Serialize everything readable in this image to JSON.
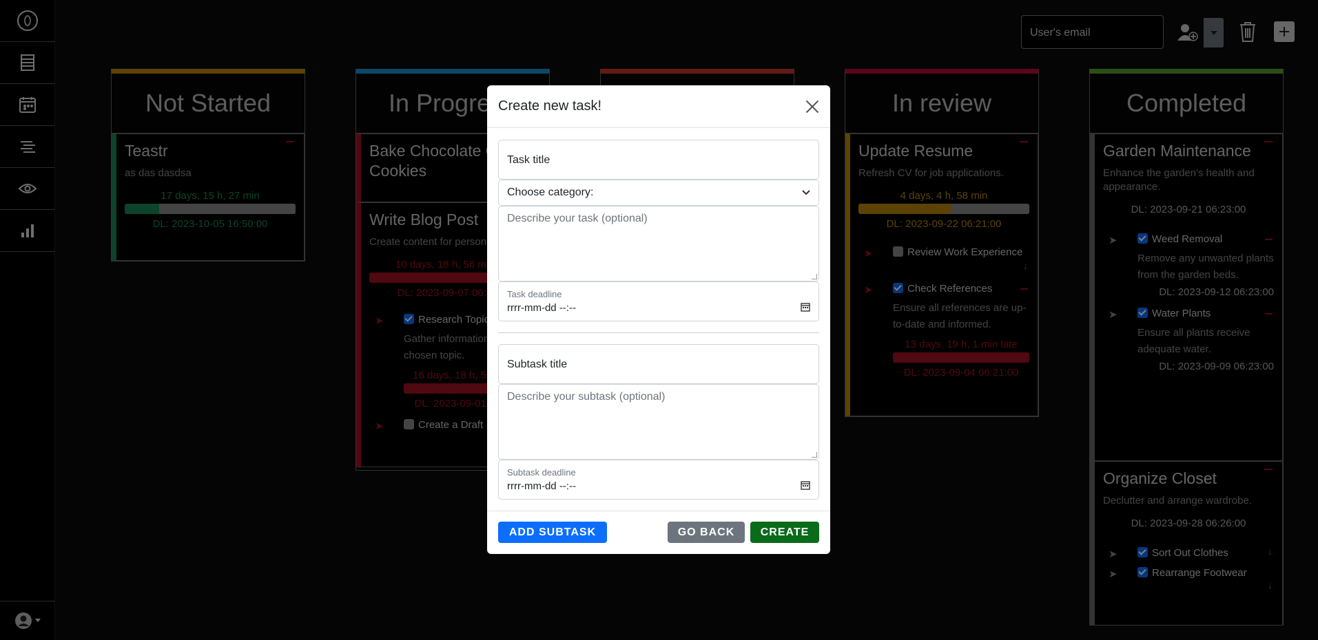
{
  "topbar": {
    "email_placeholder": "User's email"
  },
  "columns": [
    {
      "title": "Not Started",
      "color": "#b8860b",
      "cards": [
        {
          "title": "Teastr",
          "desc": "as das dasdsa",
          "timer": "17 days, 15 h, 27 min",
          "deadline": "DL: 2023-10-05 16:50:00",
          "progress": 0.2
        }
      ]
    },
    {
      "title": "In Progress",
      "color": "#1a8fd0",
      "cards": [
        {
          "title": "Bake Chocolate Chip Cookies"
        },
        {
          "title": "Write Blog Post",
          "desc": "Create content for personal blog.",
          "timer": "10 days, 18 h, 56 min late",
          "deadline": "DL: 2023-09-07 06:21:00",
          "subtasks": [
            {
              "title": "Research Topic",
              "desc": "Gather information on the chosen topic.",
              "timer": "16 days, 18 h, 56 min late",
              "deadline": "DL: 2023-09-01 06:21:00"
            },
            {
              "title": "Create a Draft"
            }
          ]
        }
      ]
    },
    {
      "title": "",
      "color": "#c0392b",
      "cards": []
    },
    {
      "title": "In review",
      "color": "#b01030",
      "cards": [
        {
          "title": "Update Resume",
          "desc": "Refresh CV for job applications.",
          "timer": "4 days, 4 h, 58 min",
          "deadline": "DL: 2023-09-22 06:21:00",
          "progress": 0.54,
          "subtasks": [
            {
              "title": "Review Work Experience"
            },
            {
              "title": "Check References",
              "desc": "Ensure all references are up-to-date and informed.",
              "timer": "13 days, 19 h, 1 min late",
              "deadline": "DL: 2023-09-04 06:21:00"
            }
          ]
        }
      ]
    },
    {
      "title": "Completed",
      "color": "#5a9e2f",
      "cards": [
        {
          "title": "Garden Maintenance",
          "desc": "Enhance the garden's health and appearance.",
          "deadline": "DL: 2023-09-21 06:23:00",
          "subtasks": [
            {
              "title": "Weed Removal",
              "desc": "Remove any unwanted plants from the garden beds.",
              "deadline": "DL: 2023-09-12 06:23:00"
            },
            {
              "title": "Water Plants",
              "desc": "Ensure all plants receive adequate water.",
              "deadline": "DL: 2023-09-09 06:23:00"
            }
          ]
        },
        {
          "title": "Organize Closet",
          "desc": "Declutter and arrange wardrobe.",
          "deadline": "DL: 2023-09-28 06:26:00",
          "subtasks": [
            {
              "title": "Sort Out Clothes"
            },
            {
              "title": "Rearrange Footwear"
            }
          ]
        }
      ]
    }
  ],
  "modal": {
    "title": "Create new task!",
    "task_title_placeholder": "Task title",
    "category_placeholder": "Choose category:",
    "task_desc_placeholder": "Describe your task (optional)",
    "task_deadline_label": "Task deadline",
    "date_placeholder": "rrrr-mm-dd --:--",
    "subtask_title_placeholder": "Subtask title",
    "subtask_desc_placeholder": "Describe your subtask (optional)",
    "subtask_deadline_label": "Subtask deadline",
    "add_subtask_label": "Add subtask",
    "go_back_label": "Go back",
    "create_label": "Create"
  },
  "colors": {
    "primary": "#0d6efd",
    "secondary": "#6c757d",
    "success": "#0a6b1a",
    "danger": "#a01220",
    "on_time_green": "#198754",
    "warning_text": "#b8860b"
  }
}
